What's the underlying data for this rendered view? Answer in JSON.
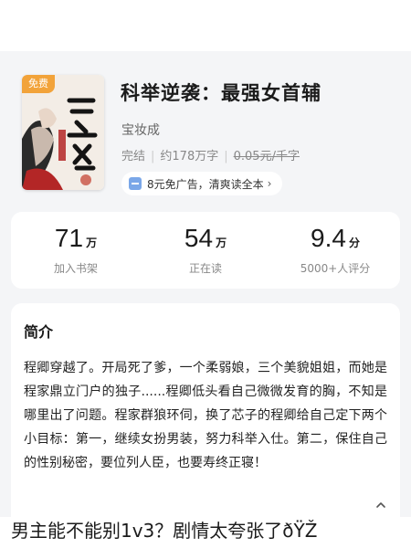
{
  "book": {
    "free_badge": "免费",
    "title": "科举逆袭：最强女首辅",
    "author": "宝妆成",
    "status": "完结",
    "word_count": "约178万字",
    "price": "0.05元/千字",
    "promo_text": "8元免广告，清爽读全本",
    "promo_chevron": "›"
  },
  "stats": [
    {
      "value": "71",
      "unit": "万",
      "label": "加入书架"
    },
    {
      "value": "54",
      "unit": "万",
      "label": "正在读"
    },
    {
      "value": "9.4",
      "unit": "分",
      "label": "5000+人评分"
    }
  ],
  "intro": {
    "heading": "简介",
    "text": "程卿穿越了。开局死了爹，一个柔弱娘，三个美貌姐姐，而她是程家鼎立门户的独子......程卿低头看自己微微发育的胸，不知是哪里出了问题。程家群狼环伺，换了芯子的程卿给自己定下两个小目标：第一，继续女扮男装，努力科举入仕。第二，保住自己的性别秘密，要位列人臣，也要寿终正寝！"
  },
  "caption": "男主能不能别1v3？剧情太夸张了ðŸŽ"
}
